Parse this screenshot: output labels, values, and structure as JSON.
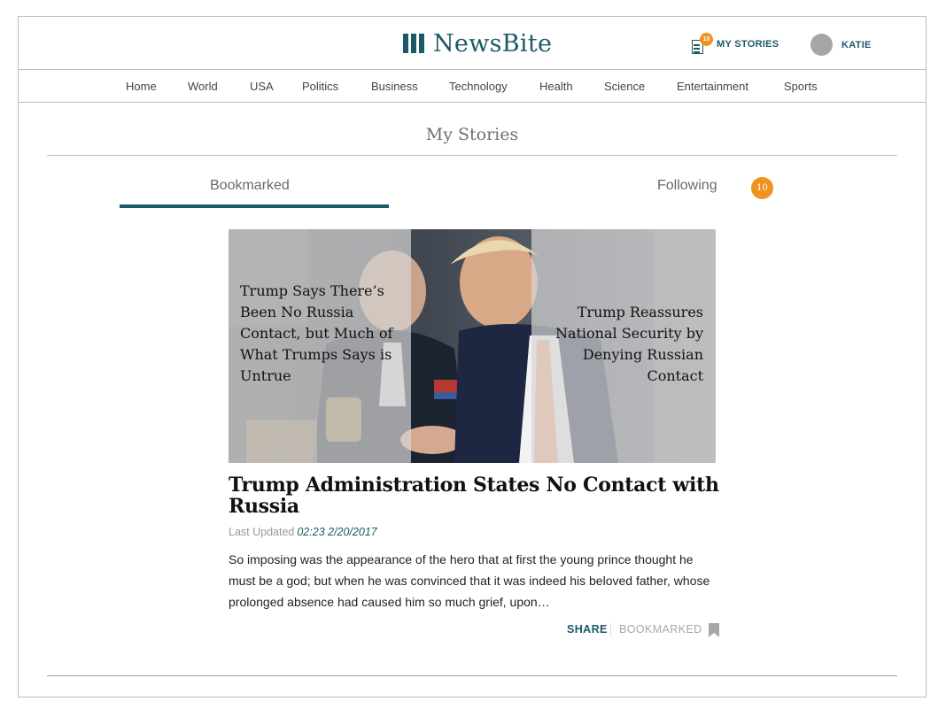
{
  "header": {
    "brand": "NewsBite",
    "my_stories_label": "MY STORIES",
    "my_stories_count": "10",
    "user_name": "KATIE"
  },
  "nav": {
    "items": [
      "Home",
      "World",
      "USA",
      "Politics",
      "Business",
      "Technology",
      "Health",
      "Science",
      "Entertainment",
      "Sports"
    ]
  },
  "page": {
    "title": "My Stories"
  },
  "tabs": {
    "bookmarked": "Bookmarked",
    "following": "Following",
    "following_count": "10",
    "active": "Bookmarked"
  },
  "story": {
    "image_headline_left": "Trump Says There’s Been No Russia Contact, but Much of What Trumps Says is Untrue",
    "image_headline_right": "Trump Reassures National Security by Denying Russian Contact",
    "headline": "Trump Administration States No Contact with Russia",
    "last_updated_label": "Last Updated",
    "last_updated_time": "02:23 2/20/2017",
    "excerpt": "So imposing was the appearance of the hero that at first the young prince thought he must be a god; but when he was convinced that it was indeed his beloved father, whose prolonged absence had caused him so much grief, upon…",
    "share_label": "SHARE",
    "bookmarked_label": "BOOKMARKED"
  },
  "colors": {
    "brand": "#1a5a67",
    "badge": "#f0931e",
    "rule": "#bdbdbd"
  },
  "icons": {
    "logo": "columns-logo-icon",
    "my_stories": "document-icon",
    "bookmark": "bookmark-icon"
  }
}
